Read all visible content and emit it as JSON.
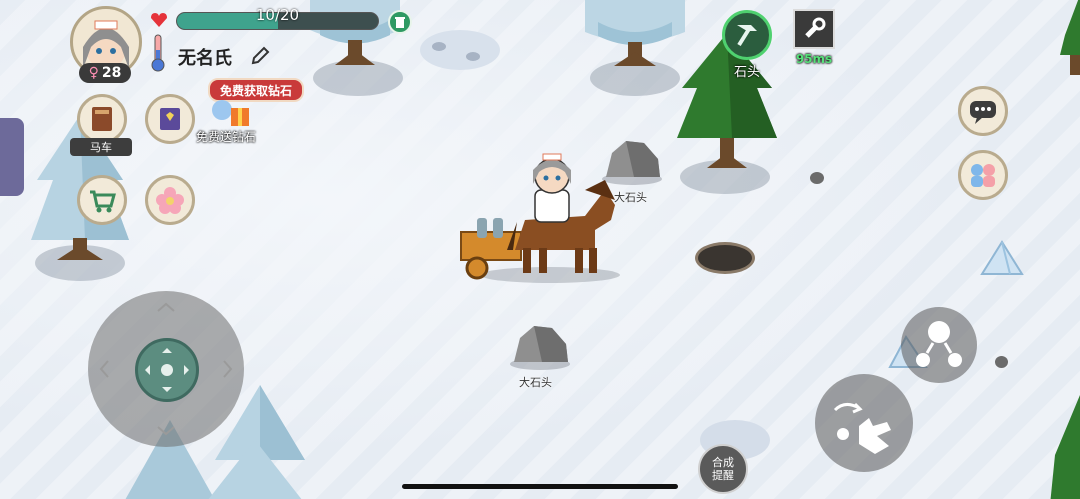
{
  "player": {
    "hp_text": "10/20",
    "hp_fraction": 0.5,
    "name": "无名氏",
    "level": "28",
    "gender_symbol": "♀"
  },
  "promo": {
    "banner": "免费获取钻石",
    "gift_label": "免费送钻石"
  },
  "menu": {
    "cart_label": "马车"
  },
  "tool": {
    "label": "石头",
    "ping": "95ms"
  },
  "world": {
    "rock_label_1": "大石头",
    "rock_label_2": "大石头"
  },
  "controls": {
    "craft_hint": "合成\n提醒"
  },
  "colors": {
    "hp_bar": "#3fa38d",
    "banner": "#c93a3a",
    "tool_ring": "#4fd16f"
  },
  "icons": [
    "heart-icon",
    "thermometer-icon",
    "trash-icon",
    "edit-icon",
    "cart-icon",
    "book-icon",
    "flower-icon",
    "chat-icon",
    "friends-icon",
    "pickaxe-icon",
    "wrench-icon",
    "hand-icon"
  ]
}
